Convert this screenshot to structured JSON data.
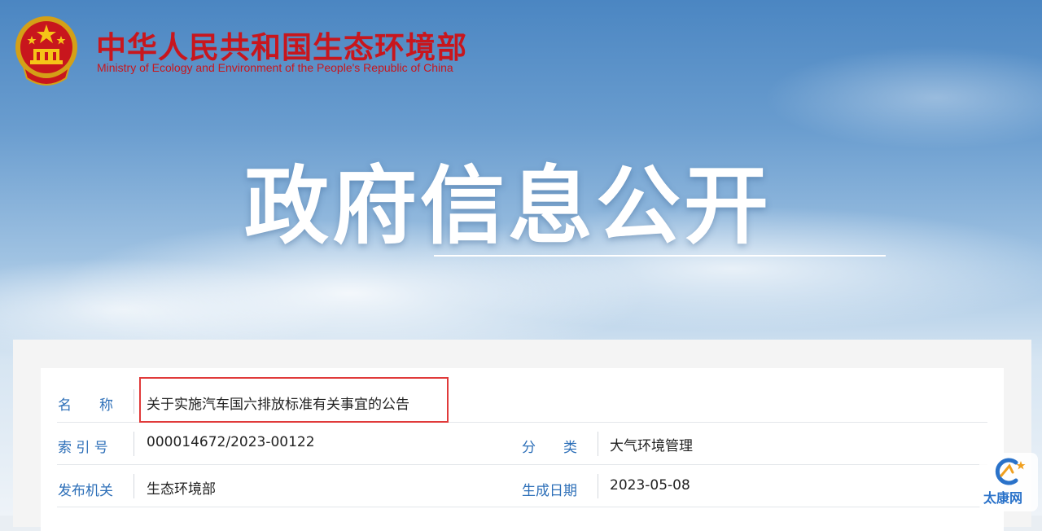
{
  "header": {
    "site_title_cn": "中华人民共和国生态环境部",
    "site_title_en": "Ministry of Ecology and Environment of the People's Republic of China"
  },
  "hero": {
    "title": "政府信息公开"
  },
  "details": {
    "name_label": "名　　称",
    "name_value": "关于实施汽车国六排放标准有关事宜的公告",
    "index_label": "索 引 号",
    "index_value": "000014672/2023-00122",
    "category_label": "分　　类",
    "category_value": "大气环境管理",
    "issuer_label": "发布机关",
    "issuer_value": "生态环境部",
    "date_label": "生成日期",
    "date_value": "2023-05-08"
  },
  "watermark": {
    "text": "太康网"
  },
  "colors": {
    "brand_red": "#c8161d",
    "label_blue": "#2d6fb8",
    "highlight_red": "#e03a3a"
  },
  "icons": {
    "emblem": "national-emblem-icon",
    "watermark_logo": "taikang-logo-icon"
  }
}
